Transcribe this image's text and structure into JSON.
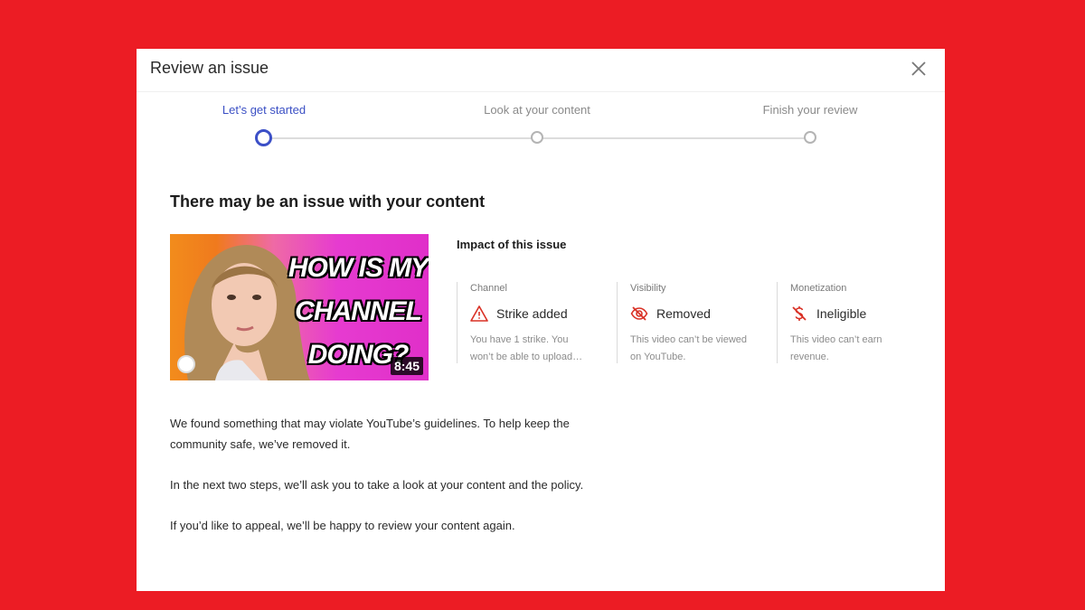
{
  "dialog": {
    "title": "Review an issue",
    "close_icon": "close-icon"
  },
  "stepper": {
    "steps": [
      {
        "label": "Let’s get started",
        "active": true
      },
      {
        "label": "Look at your content",
        "active": false
      },
      {
        "label": "Finish your review",
        "active": false
      }
    ]
  },
  "section_title": "There may be an issue with your content",
  "thumbnail": {
    "line1": "HOW IS MY",
    "line2": "CHANNEL",
    "line3": "DOING?",
    "duration": "8:45"
  },
  "impact": {
    "title": "Impact of this issue",
    "columns": [
      {
        "label": "Channel",
        "status": "Strike added",
        "icon": "warning-icon",
        "desc1": "You have 1 strike.  You",
        "desc2": "won’t be able to upload…"
      },
      {
        "label": "Visibility",
        "status": "Removed",
        "icon": "eye-off-icon",
        "desc1": "This video can’t be viewed",
        "desc2": "on YouTube."
      },
      {
        "label": "Monetization",
        "status": "Ineligible",
        "icon": "no-money-icon",
        "desc1": "This video can’t earn",
        "desc2": "revenue."
      }
    ]
  },
  "body": {
    "p1_line1": "We found something that may violate YouTube’s guidelines. To help keep the",
    "p1_line2": "community safe, we’ve removed it.",
    "p2": "In the next two steps, we’ll ask you to take a look at your content and the policy.",
    "p3": "If you’d like to appeal, we’ll be happy to review your content again."
  },
  "colors": {
    "background": "#ec1c24",
    "accent": "#3b4fc7",
    "icon_red": "#d93025"
  }
}
